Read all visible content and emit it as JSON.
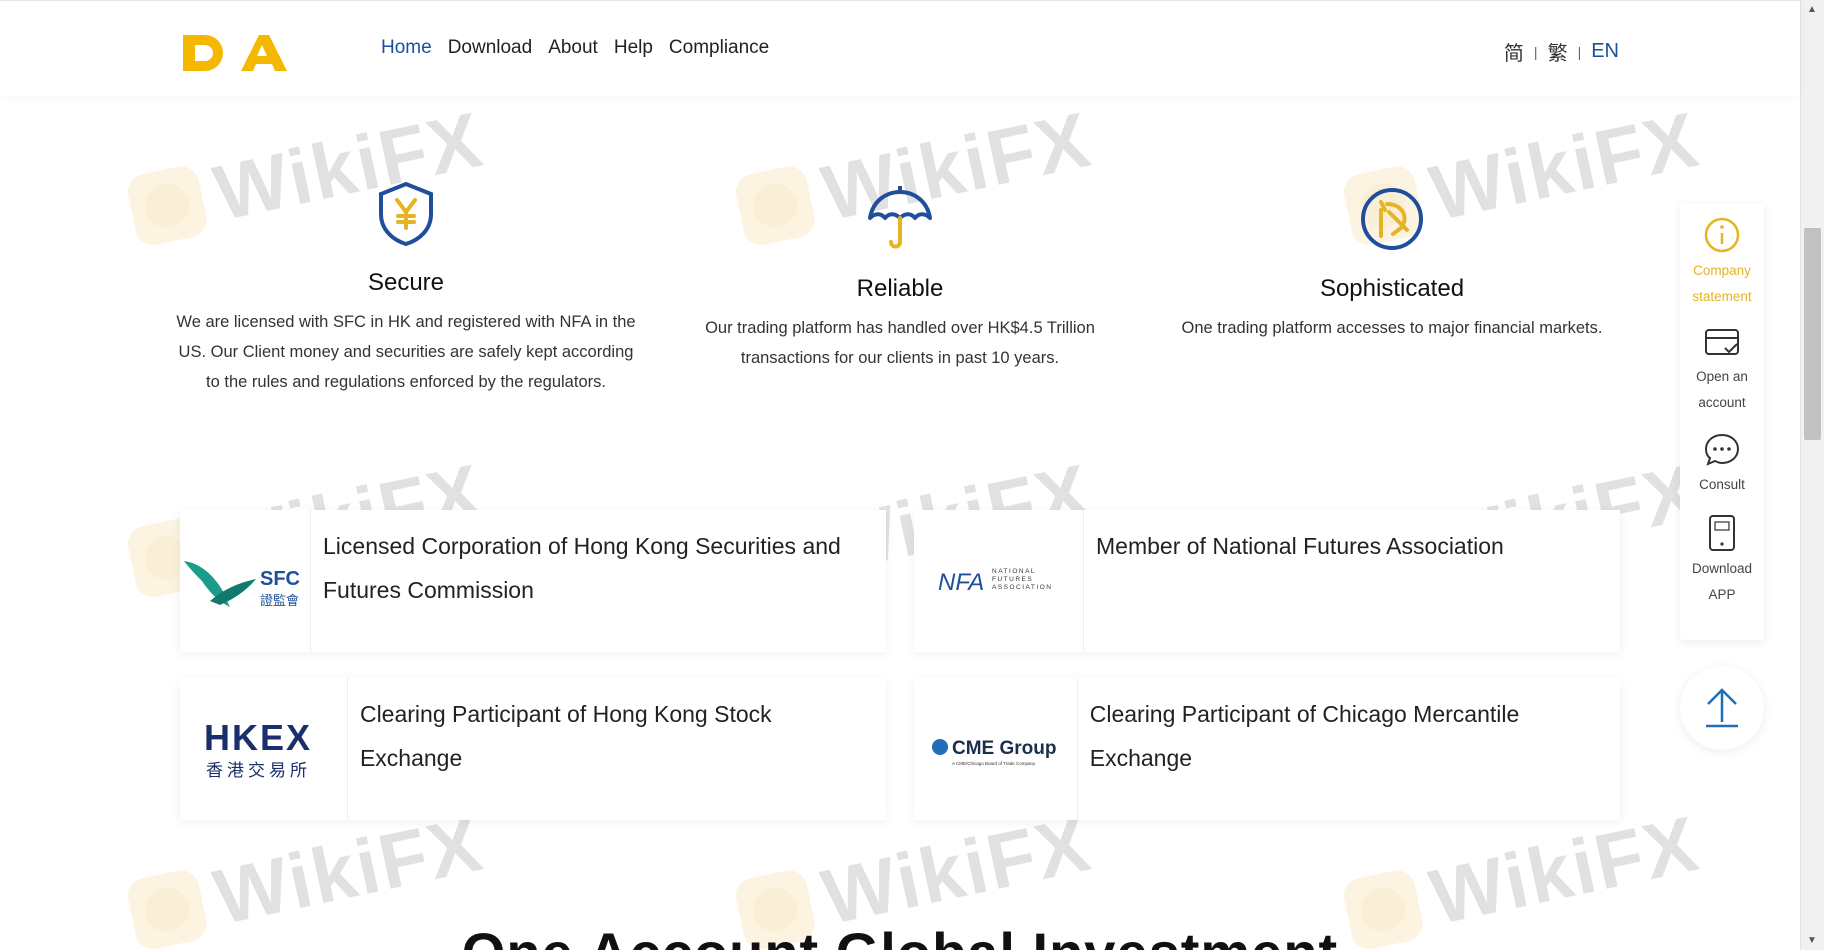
{
  "brand": {
    "logo_text": "DA",
    "logo_color": "#f5b800"
  },
  "nav": [
    {
      "label": "Home",
      "active": true
    },
    {
      "label": "Download"
    },
    {
      "label": "About"
    },
    {
      "label": "Help"
    },
    {
      "label": "Compliance"
    }
  ],
  "lang": {
    "simplified": "简",
    "traditional": "繁",
    "english": "EN",
    "sep": "|"
  },
  "features": [
    {
      "title": "Secure",
      "desc": "We are licensed with SFC in HK and registered with NFA in the US. Our Client money and securities are safely kept according to the rules and regulations enforced by the regulators.",
      "icon": "shield-yen-icon"
    },
    {
      "title": "Reliable",
      "desc": "Our trading platform has handled over HK$4.5 Trillion transactions for our clients in past 10 years.",
      "icon": "umbrella-icon"
    },
    {
      "title": "Sophisticated",
      "desc": "One trading platform accesses to major financial markets.",
      "icon": "chart-circle-icon"
    }
  ],
  "cards": [
    {
      "logo": "SFC",
      "logo_sub": "證監會",
      "text": "Licensed Corporation of Hong Kong Securities and Futures Commission"
    },
    {
      "logo": "NFA",
      "logo_sub": "NATIONAL FUTURES ASSOCIATION",
      "text": "Member of National Futures Association"
    },
    {
      "logo": "HKEX",
      "logo_sub": "香港交易所",
      "text": "Clearing Participant of Hong Kong Stock Exchange"
    },
    {
      "logo": "CME Group",
      "logo_sub": "A CME/Chicago Board of Trade Company",
      "text": "Clearing Participant of Chicago Mercantile Exchange"
    }
  ],
  "side": {
    "company": "Company statement",
    "open": "Open an account",
    "consult": "Consult",
    "download": "Download APP"
  },
  "watermark": "WikiFX",
  "bottom_title": "One Account Global Investment",
  "colors": {
    "accent_blue": "#1f4f9c",
    "accent_yellow": "#e6b422"
  }
}
